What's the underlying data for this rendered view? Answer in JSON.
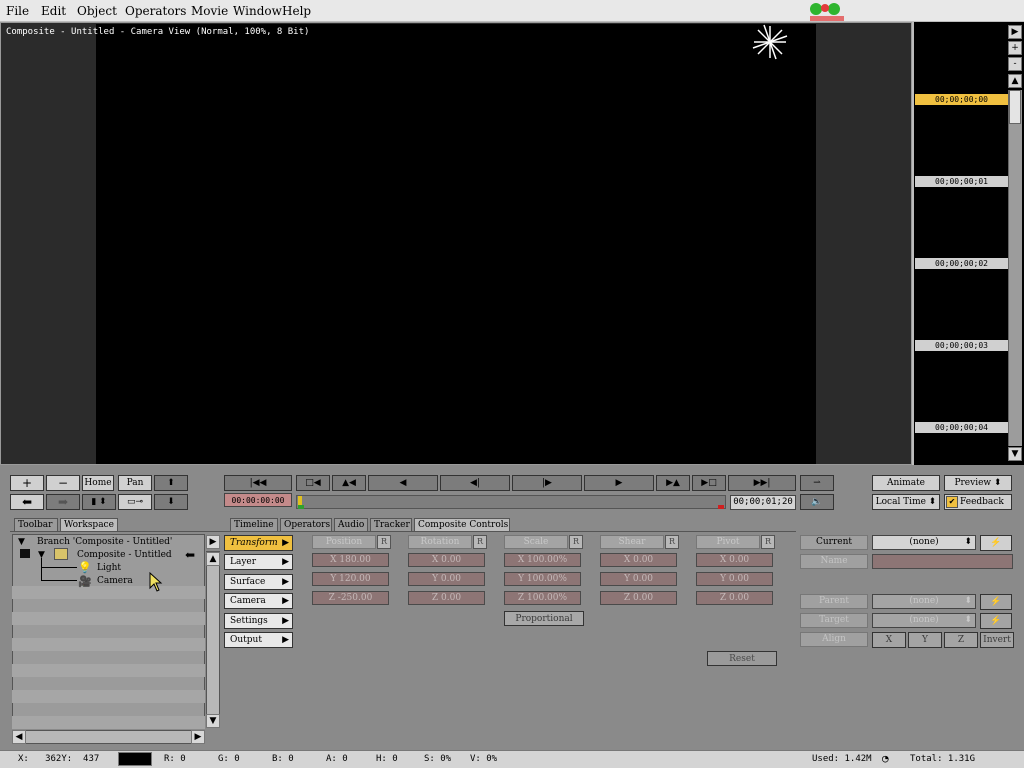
{
  "menu": [
    "File",
    "Edit",
    "Object",
    "Operators",
    "Movie",
    "Window",
    "Help"
  ],
  "viewer": {
    "title": "Composite - Untitled - Camera View (Normal, 100%, 8 Bit)"
  },
  "timeline": {
    "timecodes": [
      "00;00;00;00",
      "00;00;00;01",
      "00;00;00;02",
      "00;00;00;03",
      "00;00;00;04"
    ],
    "zoom_buttons": [
      "+",
      "-"
    ]
  },
  "nav_buttons": {
    "plus": "+",
    "minus": "−",
    "home": "Home",
    "pan": "Pan"
  },
  "transport": {
    "current_time": "00:00:00:00",
    "end_time": "00;00;01;20",
    "animate": "Animate",
    "preview": "Preview",
    "local_time": "Local Time",
    "feedback": "Feedback"
  },
  "tabs_left": [
    "Toolbar",
    "Workspace"
  ],
  "tabs_main": [
    "Timeline",
    "Operators",
    "Audio",
    "Tracker",
    "Composite Controls"
  ],
  "tree": {
    "branch": "Branch 'Composite - Untitled'",
    "composite": "Composite - Untitled",
    "light": "Light",
    "camera": "Camera"
  },
  "controls": [
    "Transform",
    "Layer",
    "Surface",
    "Camera",
    "Settings",
    "Output"
  ],
  "properties": {
    "headers": [
      "Position",
      "Rotation",
      "Scale",
      "Shear",
      "Pivot"
    ],
    "r_label": "R",
    "rows": [
      [
        "X 180.00",
        "X 0.00",
        "X 100.00%",
        "X 0.00",
        "X 0.00"
      ],
      [
        "Y 120.00",
        "Y 0.00",
        "Y 100.00%",
        "Y 0.00",
        "Y 0.00"
      ],
      [
        "Z -250.00",
        "Z 0.00",
        "Z 100.00%",
        "Z 0.00",
        "Z 0.00"
      ]
    ],
    "proportional": "Proportional",
    "reset": "Reset"
  },
  "right_panel": {
    "current_label": "Current",
    "current_value": "(none)",
    "name_label": "Name",
    "parent_label": "Parent",
    "parent_value": "(none)",
    "target_label": "Target",
    "target_value": "(none)",
    "align_label": "Align",
    "align_buttons": [
      "X",
      "Y",
      "Z",
      "Invert"
    ]
  },
  "status": {
    "coords": "X:   362Y:  437",
    "r": "R: 0",
    "g": "G: 0",
    "b": "B: 0",
    "a": "A: 0",
    "h": "H: 0",
    "s": "S: 0%",
    "v": "V: 0%",
    "used": "Used: 1.42M",
    "total": "Total: 1.31G"
  },
  "colors": {
    "selection": "#f0c040",
    "viewer_bg": "#000000",
    "panel": "#8a8a8a"
  }
}
